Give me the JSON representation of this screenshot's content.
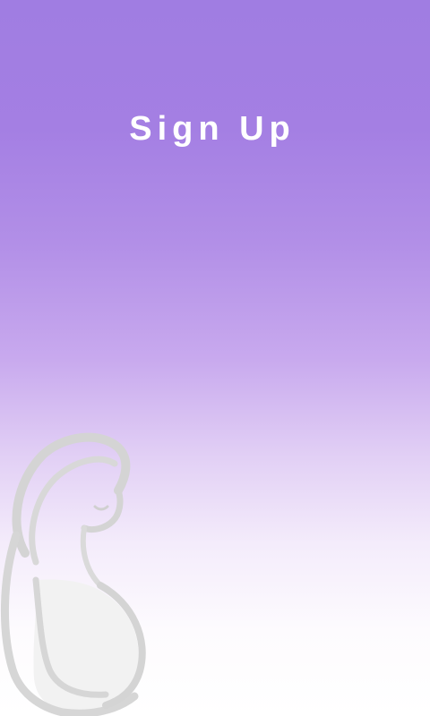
{
  "screen": {
    "title": "Sign Up"
  },
  "illustration": {
    "icon": "pregnant-woman-silhouette-icon"
  },
  "colors": {
    "gradient_top": "#a07de2",
    "gradient_bottom": "#ffffff",
    "title_text": "#ffffff",
    "illustration_stroke": "#d4d4d4",
    "illustration_fill": "#f2f2f2"
  }
}
